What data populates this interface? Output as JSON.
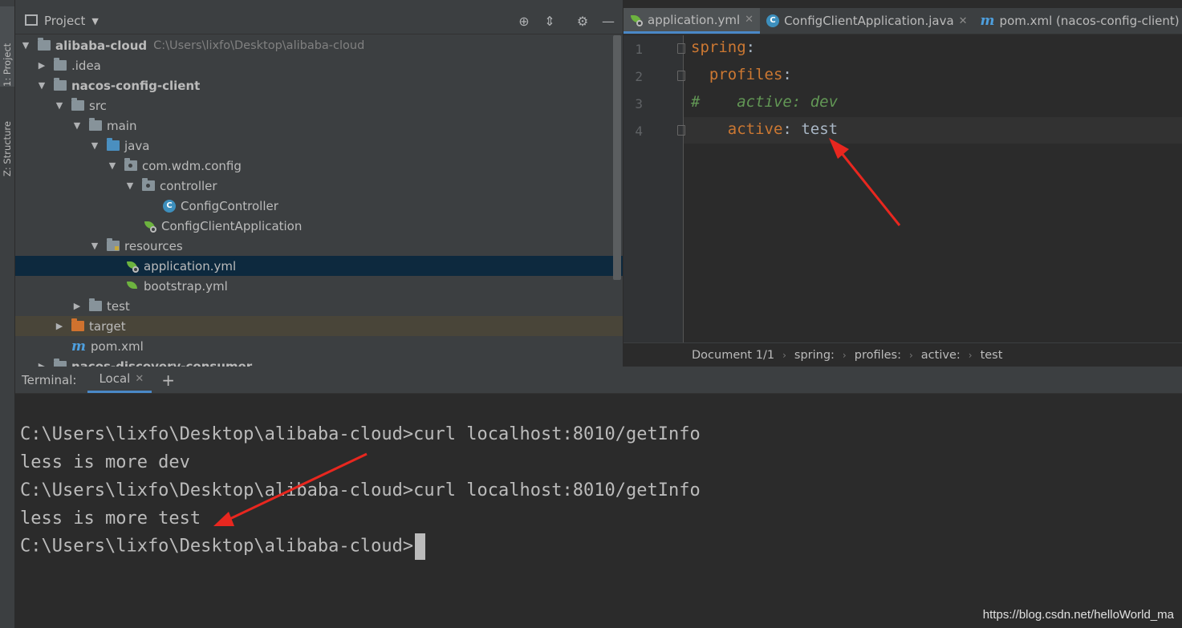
{
  "toolstrip": {
    "project_tab": "1: Project",
    "structure_tab": "Z: Structure"
  },
  "project": {
    "title": "Project",
    "tree": [
      {
        "label": "alibaba-cloud",
        "path": "C:\\Users\\lixfo\\Desktop\\alibaba-cloud"
      },
      {
        "label": ".idea"
      },
      {
        "label": "nacos-config-client"
      },
      {
        "label": "src"
      },
      {
        "label": "main"
      },
      {
        "label": "java"
      },
      {
        "label": "com.wdm.config"
      },
      {
        "label": "controller"
      },
      {
        "label": "ConfigController"
      },
      {
        "label": "ConfigClientApplication"
      },
      {
        "label": "resources"
      },
      {
        "label": "application.yml"
      },
      {
        "label": "bootstrap.yml"
      },
      {
        "label": "test"
      },
      {
        "label": "target"
      },
      {
        "label": "pom.xml"
      },
      {
        "label": "nacos-discovery-consumer"
      }
    ]
  },
  "editor": {
    "tabs": [
      {
        "label": "application.yml"
      },
      {
        "label": "ConfigClientApplication.java"
      },
      {
        "label": "pom.xml (nacos-config-client)"
      }
    ],
    "line_numbers": [
      "1",
      "2",
      "3",
      "4"
    ],
    "code": {
      "l1_key": "spring",
      "colon": ":",
      "l2_key": "profiles",
      "l3_comment": "#    active: dev",
      "l4_key": "active",
      "l4_value": "test"
    },
    "breadcrumb": [
      "Document 1/1",
      "spring:",
      "profiles:",
      "active:",
      "test"
    ]
  },
  "terminal": {
    "label": "Terminal:",
    "tab": "Local",
    "lines": [
      "C:\\Users\\lixfo\\Desktop\\alibaba-cloud>curl localhost:8010/getInfo",
      "less is more dev",
      "C:\\Users\\lixfo\\Desktop\\alibaba-cloud>curl localhost:8010/getInfo",
      "less is more test",
      "C:\\Users\\lixfo\\Desktop\\alibaba-cloud>"
    ]
  },
  "watermark": "https://blog.csdn.net/helloWorld_ma",
  "colors": {
    "accent": "#4a88c7",
    "selection": "#0d293e",
    "annotation": "#e8271f"
  }
}
